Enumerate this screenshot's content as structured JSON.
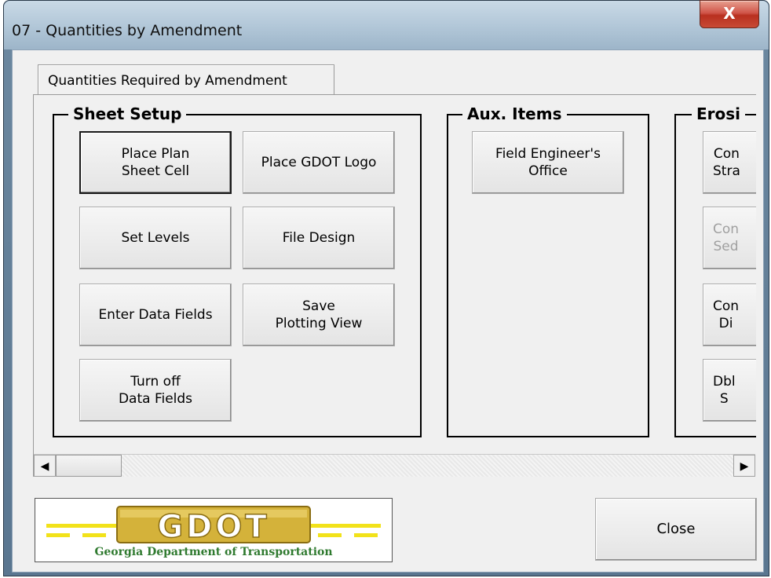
{
  "window": {
    "title": "07 - Quantities by Amendment",
    "close_glyph": "X"
  },
  "tab": {
    "label": "Quantities Required by Amendment"
  },
  "sheet_setup": {
    "title": "Sheet Setup",
    "buttons": {
      "place_plan_sheet_cell": "Place Plan\nSheet Cell",
      "place_gdot_logo": "Place GDOT Logo",
      "set_levels": "Set Levels",
      "file_design": "File Design",
      "enter_data_fields": "Enter Data Fields",
      "save_plotting_view": "Save\nPlotting View",
      "turn_off_data_fields": "Turn off\nData Fields"
    }
  },
  "aux_items": {
    "title": "Aux. Items",
    "buttons": {
      "field_engineers_office": "Field Engineer's\nOffice"
    }
  },
  "erosion": {
    "title": "Erosi",
    "buttons": {
      "b1": "Con\nStra",
      "b2": "Con\nSed",
      "b3": "Con\nDi",
      "b4": "Dbl\nS"
    }
  },
  "scrollbar": {
    "left_arrow": "◀",
    "right_arrow": "▶"
  },
  "logo": {
    "wordmark": "GDOT",
    "caption": "Georgia Department of Transportation",
    "colors": {
      "gold": "#d4b23a",
      "yellow": "#f2e21a",
      "green": "#2f7a2f"
    }
  },
  "footer": {
    "close_label": "Close"
  }
}
